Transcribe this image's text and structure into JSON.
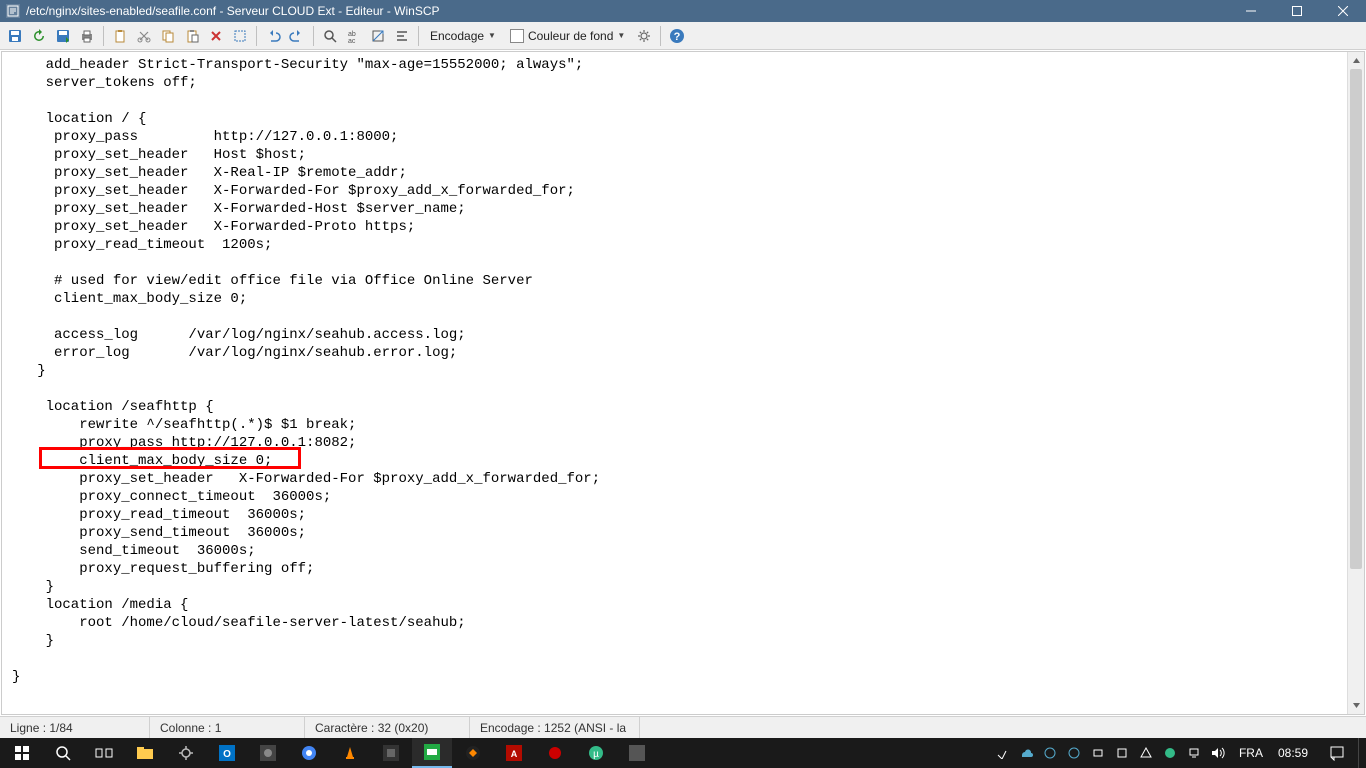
{
  "titlebar": {
    "text": "/etc/nginx/sites-enabled/seafile.conf - Serveur CLOUD Ext - Editeur - WinSCP"
  },
  "toolbar": {
    "encoding_label": "Encodage",
    "bgcolor_label": "Couleur de fond"
  },
  "code_lines": [
    "    add_header Strict-Transport-Security \"max-age=15552000; always\";",
    "    server_tokens off;",
    "",
    "    location / {",
    "     proxy_pass         http://127.0.0.1:8000;",
    "     proxy_set_header   Host $host;",
    "     proxy_set_header   X-Real-IP $remote_addr;",
    "     proxy_set_header   X-Forwarded-For $proxy_add_x_forwarded_for;",
    "     proxy_set_header   X-Forwarded-Host $server_name;",
    "     proxy_set_header   X-Forwarded-Proto https;",
    "     proxy_read_timeout  1200s;",
    "",
    "     # used for view/edit office file via Office Online Server",
    "     client_max_body_size 0;",
    "",
    "     access_log      /var/log/nginx/seahub.access.log;",
    "     error_log       /var/log/nginx/seahub.error.log;",
    "   }",
    "",
    "    location /seafhttp {",
    "        rewrite ^/seafhttp(.*)$ $1 break;",
    "        proxy_pass http://127.0.0.1:8082;",
    "        client_max_body_size 0;",
    "        proxy_set_header   X-Forwarded-For $proxy_add_x_forwarded_for;",
    "        proxy_connect_timeout  36000s;",
    "        proxy_read_timeout  36000s;",
    "        proxy_send_timeout  36000s;",
    "        send_timeout  36000s;",
    "        proxy_request_buffering off;",
    "    }",
    "    location /media {",
    "        root /home/cloud/seafile-server-latest/seahub;",
    "    }",
    "",
    "}",
    ""
  ],
  "highlight": {
    "top_line_index": 22,
    "left_ch": 4,
    "width_ch": 34
  },
  "statusbar": {
    "line": "Ligne : 1/84",
    "col": "Colonne : 1",
    "char": "Caractère : 32 (0x20)",
    "encoding": "Encodage : 1252  (ANSI - la"
  },
  "taskbar": {
    "lang": "FRA",
    "time": "08:59"
  }
}
